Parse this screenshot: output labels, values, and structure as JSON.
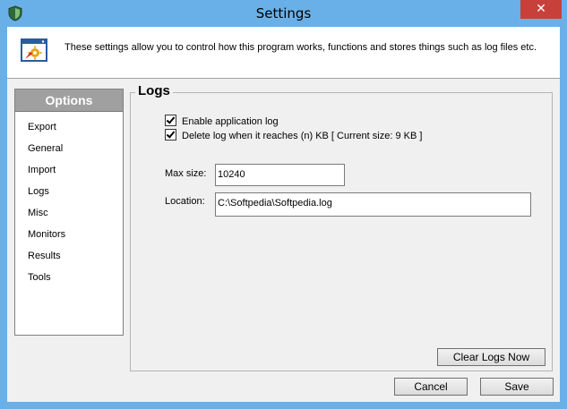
{
  "window": {
    "title": "Settings",
    "close_label": "✕"
  },
  "banner": {
    "text": "These settings allow you to control how this program works, functions and stores things such as log files etc."
  },
  "options": {
    "header": "Options",
    "items": [
      "Export",
      "General",
      "Import",
      "Logs",
      "Misc",
      "Monitors",
      "Results",
      "Tools"
    ]
  },
  "logs": {
    "title": "Logs",
    "enable_label": "Enable application log",
    "enable_checked": true,
    "delete_label": "Delete log when it reaches (n) KB [ Current size: 9 KB ]",
    "delete_checked": true,
    "max_size_label": "Max size:",
    "max_size_value": "10240",
    "location_label": "Location:",
    "location_value": "C:\\Softpedia\\Softpedia.log",
    "clear_button": "Clear Logs Now"
  },
  "footer": {
    "cancel_button": "Cancel",
    "save_button": "Save"
  },
  "colors": {
    "titlebar": "#6ab0e8",
    "close": "#c7413a",
    "client": "#f0f0f0"
  },
  "icons": {
    "app": "shield-icon",
    "banner": "settings-window-icon"
  }
}
